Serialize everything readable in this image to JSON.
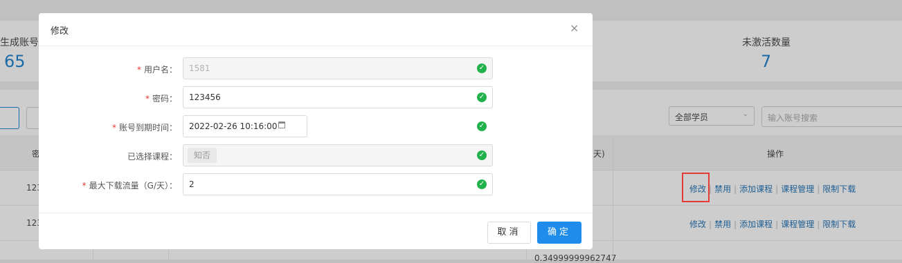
{
  "background": {
    "stats": [
      {
        "label": "生成账号",
        "value": "65"
      },
      {
        "label": "未激活数量",
        "value": "7"
      }
    ],
    "filters": {
      "student_select": "全部学员",
      "search_placeholder": "输入账号搜索"
    },
    "table": {
      "header_partial_left": "密",
      "header_partial_mid": "天)",
      "header_actions": "操作",
      "rows": [
        {
          "account_partial": "123"
        },
        {
          "account_partial": "123"
        }
      ],
      "partial_value_row3": "0.34999999962747",
      "actions": {
        "edit": "修改",
        "disable": "禁用",
        "add_course": "添加课程",
        "course_manage": "课程管理",
        "limit_download": "限制下载"
      }
    }
  },
  "modal": {
    "title": "修改",
    "close_symbol": "×",
    "fields": {
      "username": {
        "label": "用户名：",
        "value": "1581"
      },
      "password": {
        "label": "密码：",
        "value": "123456"
      },
      "expiry": {
        "label": "账号到期时间：",
        "value": "2022-02-26 10:16:00"
      },
      "courses": {
        "label": "已选择课程：",
        "tag": "知否"
      },
      "max_download": {
        "label": "最大下载流量（G/天）：",
        "value": "2"
      }
    },
    "required_mark": "*",
    "check_symbol": "✓",
    "buttons": {
      "cancel": "取消",
      "ok": "确定"
    }
  },
  "colors": {
    "primary": "#1f8ceb",
    "success": "#21b24b",
    "required": "#e5392e",
    "highlight": "#e53935"
  }
}
